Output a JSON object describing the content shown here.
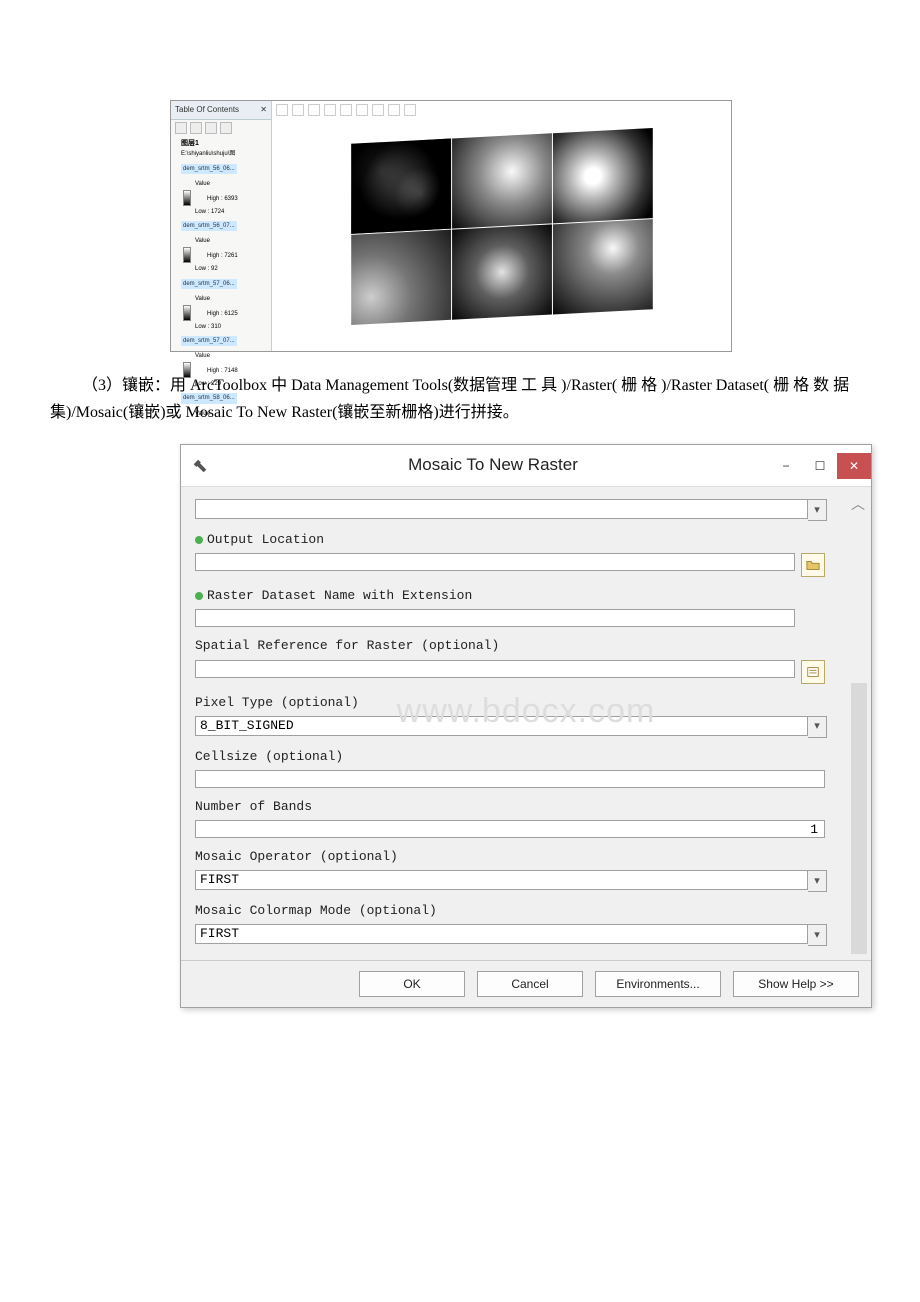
{
  "arcmap": {
    "toc_title": "Table Of Contents",
    "toc_pin": "✕",
    "dataframe": "图层1",
    "source": "E:\\shiyanliu\\shuju\\图",
    "layers": [
      {
        "name": "dem_srtm_56_06...",
        "value_label": "Value",
        "high": "High : 6393",
        "low": "Low : 1724"
      },
      {
        "name": "dem_srtm_56_07...",
        "value_label": "Value",
        "high": "High : 7261",
        "low": "Low : 92"
      },
      {
        "name": "dem_srtm_57_06...",
        "value_label": "Value",
        "high": "High : 6125",
        "low": "Low : 310"
      },
      {
        "name": "dem_srtm_57_07...",
        "value_label": "Value",
        "high": "High : 7148",
        "low": "Low : 229"
      },
      {
        "name": "dem_srtm_58_06...",
        "value_label": "Value",
        "high": "",
        "low": ""
      }
    ]
  },
  "paragraph": "（3）镶嵌：用 ArcToolbox 中 Data Management Tools(数据管理 工 具 )/Raster( 栅 格 )/Raster Dataset( 栅 格 数 据集)/Mosaic(镶嵌)或 Mosaic To New Raster(镶嵌至新栅格)进行拼接。",
  "dialog": {
    "title": "Mosaic To New Raster",
    "fields": {
      "input_rasters": {
        "value": ""
      },
      "output_location": {
        "label": "Output Location",
        "value": ""
      },
      "raster_name": {
        "label": "Raster Dataset Name with Extension",
        "value": ""
      },
      "spatial_ref": {
        "label": "Spatial Reference for Raster (optional)",
        "value": ""
      },
      "pixel_type": {
        "label": "Pixel Type (optional)",
        "value": "8_BIT_SIGNED"
      },
      "cellsize": {
        "label": "Cellsize (optional)",
        "value": ""
      },
      "bands": {
        "label": "Number of Bands",
        "value": "1"
      },
      "mosaic_op": {
        "label": "Mosaic Operator (optional)",
        "value": "FIRST"
      },
      "colormap": {
        "label": "Mosaic Colormap Mode (optional)",
        "value": "FIRST"
      }
    },
    "buttons": {
      "ok": "OK",
      "cancel": "Cancel",
      "env": "Environments...",
      "help": "Show Help >>"
    },
    "win": {
      "min": "−",
      "max": "☐",
      "close": "✕"
    }
  },
  "watermark": "www.bdocx.com"
}
